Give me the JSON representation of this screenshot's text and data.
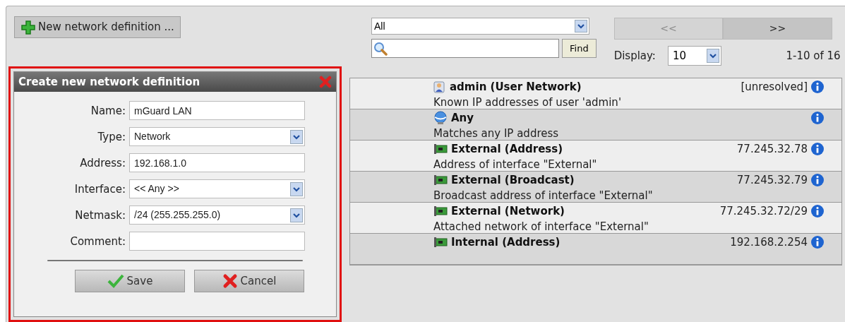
{
  "toolbar": {
    "new_button": "New network definition ...",
    "filter": {
      "value": "All"
    },
    "search": {
      "button": "Find"
    },
    "pager": [
      {
        "label": "<<",
        "disabled": true
      },
      {
        "label": ">>",
        "disabled": false
      }
    ],
    "display_label": "Display:",
    "display_value": "10",
    "range": "1-10 of 16"
  },
  "dialog": {
    "title": "Create new network definition",
    "fields": [
      {
        "label": "Name:",
        "kind": "text",
        "value": "mGuard LAN"
      },
      {
        "label": "Type:",
        "kind": "select",
        "value": "Network"
      },
      {
        "label": "Address:",
        "kind": "text",
        "value": "192.168.1.0"
      },
      {
        "label": "Interface:",
        "kind": "select",
        "value": "<< Any >>"
      },
      {
        "label": "Netmask:",
        "kind": "select",
        "value": "/24 (255.255.255.0)"
      },
      {
        "label": "Comment:",
        "kind": "text"
      }
    ],
    "buttons": [
      {
        "kind": "save",
        "label": "Save"
      },
      {
        "kind": "cancel",
        "label": "Cancel"
      }
    ]
  },
  "networks": [
    {
      "kind": "user",
      "name": "admin (User Network)",
      "value": "[unresolved]",
      "description": "Known IP addresses of user 'admin'"
    },
    {
      "kind": "any",
      "name": "Any",
      "description": "Matches any IP address"
    },
    {
      "kind": "interface",
      "name": "External (Address)",
      "value": "77.245.32.78",
      "description": "Address of interface \"External\""
    },
    {
      "kind": "interface",
      "name": "External (Broadcast)",
      "value": "77.245.32.79",
      "description": "Broadcast address of interface \"External\""
    },
    {
      "kind": "interface",
      "name": "External (Network)",
      "value": "77.245.32.72/29",
      "description": "Attached network of interface \"External\""
    },
    {
      "kind": "interface",
      "name": "Internal (Address)",
      "value": "192.168.2.254"
    }
  ]
}
